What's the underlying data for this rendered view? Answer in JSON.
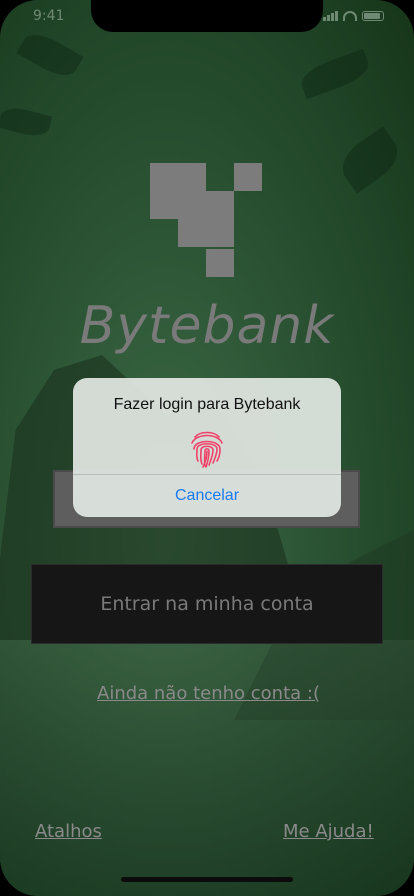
{
  "status_bar": {
    "time": "9:41"
  },
  "app": {
    "brand_name": "Bytebank"
  },
  "actions": {
    "login_button": "Entrar na minha conta",
    "signup_link": "Ainda não tenho conta :(",
    "shortcuts_link": "Atalhos",
    "help_link": "Me Ajuda!"
  },
  "touch_id_dialog": {
    "title": "Fazer login para Bytebank",
    "icon": "fingerprint-icon",
    "cancel_label": "Cancelar"
  },
  "colors": {
    "background": "#2c5535",
    "logo": "#7c7c7c",
    "button": "#161616",
    "dialog": "#dce2dd",
    "accent": "#1a7bf2",
    "fingerprint": "#f0426a"
  }
}
